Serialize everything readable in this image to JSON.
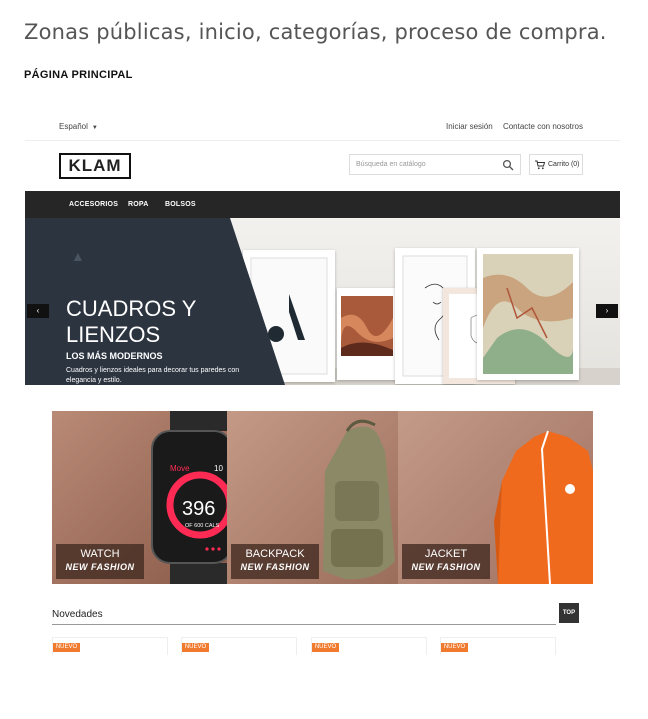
{
  "doc": {
    "title": "Zonas públicas, inicio, categorías, proceso de compra.",
    "subtitle": "PÁGINA PRINCIPAL"
  },
  "topbar": {
    "language": "Español",
    "login": "Iniciar sesión",
    "contact": "Contacte con nosotros"
  },
  "header": {
    "logo": "KLAM",
    "search_placeholder": "Búsqueda en catálogo",
    "cart": "Carrito (0)"
  },
  "nav": {
    "items": [
      "ACCESORIOS",
      "ROPA",
      "BOLSOS"
    ]
  },
  "slider": {
    "title_line1": "CUADROS Y",
    "title_line2": "LIENZOS",
    "subtitle": "LOS MÁS MODERNOS",
    "text": "Cuadros y lienzos ideales para decorar tus paredes con elegancia y estilo.",
    "prev": "‹",
    "next": "›"
  },
  "banners": [
    {
      "title": "WATCH",
      "tag": "NEW FASHION",
      "screen_label": "Move",
      "screen_value": "396",
      "screen_sub": "OF 600 CALS",
      "screen_num": "10"
    },
    {
      "title": "BACKPACK",
      "tag": "NEW FASHION"
    },
    {
      "title": "JACKET",
      "tag": "NEW FASHION"
    }
  ],
  "news": {
    "title": "Novedades",
    "top_button": "TOP",
    "badges": [
      "NUEVO",
      "NUEVO",
      "NUEVO",
      "NUEVO"
    ]
  },
  "colors": {
    "nav_bg": "#262626",
    "slide_panel": "#2c3440",
    "badge": "#f07b2f",
    "jacket": "#f06a1e"
  }
}
